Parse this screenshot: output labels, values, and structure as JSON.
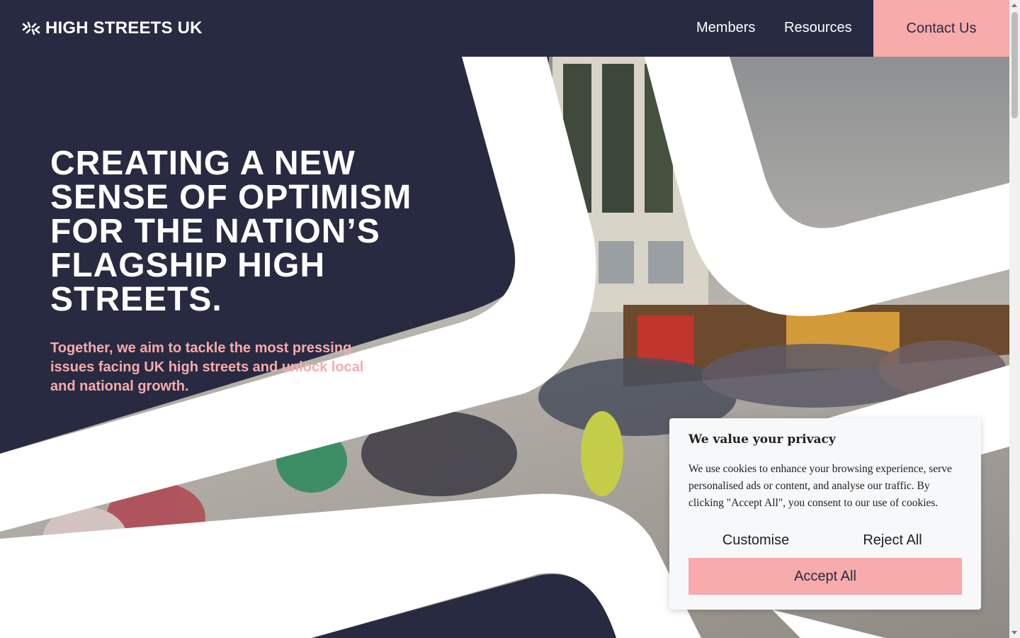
{
  "header": {
    "logo_text": "HIGH STREETS UK",
    "nav": {
      "members": "Members",
      "resources": "Resources"
    },
    "contact_label": "Contact Us"
  },
  "hero": {
    "title": "CREATING A NEW SENSE OF OPTIMISM FOR THE NATION’S FLAGSHIP HIGH STREETS.",
    "subtitle": "Together, we aim to tackle the most pressing issues facing UK high streets and unlock local and national growth."
  },
  "cookie_banner": {
    "title": "We value your privacy",
    "text": "We use cookies to enhance your browsing experience, serve personalised ads or content, and analyse our traffic. By clicking \"Accept All\", you consent to our use of cookies.",
    "customise_label": "Customise",
    "reject_label": "Reject All",
    "accept_label": "Accept All"
  },
  "colors": {
    "navy": "#282a41",
    "pink": "#f7abab",
    "white": "#ffffff"
  },
  "icons": {
    "logo": "high-streets-logo-icon"
  }
}
